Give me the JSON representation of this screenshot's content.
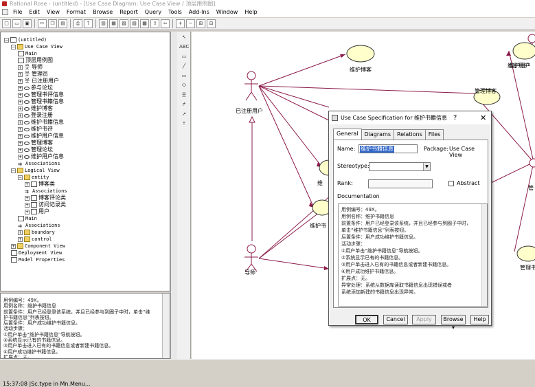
{
  "window": {
    "title": "Rational Rose - (untitled) - [Use Case Diagram: Use Case View / 顶层用例图]"
  },
  "menu": [
    "File",
    "Edit",
    "View",
    "Format",
    "Browse",
    "Report",
    "Query",
    "Tools",
    "Add-Ins",
    "Window",
    "Help"
  ],
  "browser": {
    "root": "(untitled)",
    "items": [
      {
        "label": "Use Case View",
        "icon": "folder",
        "level": 1,
        "mono": true
      },
      {
        "label": "Main",
        "icon": "diagram",
        "level": 2,
        "mono": true
      },
      {
        "label": "顶层用例图",
        "icon": "diagram",
        "level": 2
      },
      {
        "label": "导师",
        "icon": "actor",
        "level": 2
      },
      {
        "label": "管理员",
        "icon": "actor",
        "level": 2
      },
      {
        "label": "已注册用户",
        "icon": "actor",
        "level": 2
      },
      {
        "label": "参与论坛",
        "icon": "usecase",
        "level": 2
      },
      {
        "label": "管理书评信息",
        "icon": "usecase",
        "level": 2
      },
      {
        "label": "管理书籍信息",
        "icon": "usecase",
        "level": 2
      },
      {
        "label": "维护博客",
        "icon": "usecase",
        "level": 2
      },
      {
        "label": "登录注册",
        "icon": "usecase",
        "level": 2
      },
      {
        "label": "维护书籍信息",
        "icon": "usecase",
        "level": 2
      },
      {
        "label": "维护书评",
        "icon": "usecase",
        "level": 2
      },
      {
        "label": "维护用户信息",
        "icon": "usecase",
        "level": 2
      },
      {
        "label": "管理博客",
        "icon": "usecase",
        "level": 2
      },
      {
        "label": "管理论坛",
        "icon": "usecase",
        "level": 2
      },
      {
        "label": "维护用户信息",
        "icon": "usecase",
        "level": 2
      },
      {
        "label": "Associations",
        "icon": "assoc",
        "level": 2,
        "mono": true
      },
      {
        "label": "Logical View",
        "icon": "folder",
        "level": 1,
        "mono": true
      },
      {
        "label": "entity",
        "icon": "folder",
        "level": 2,
        "mono": true
      },
      {
        "label": "博客类",
        "icon": "class",
        "level": 3
      },
      {
        "label": "Associations",
        "icon": "assoc",
        "level": 3,
        "mono": true
      },
      {
        "label": "博客评论类",
        "icon": "class",
        "level": 3
      },
      {
        "label": "访问记录类",
        "icon": "class",
        "level": 3
      },
      {
        "label": "用户",
        "icon": "class",
        "level": 3
      },
      {
        "label": "Main",
        "icon": "diagram",
        "level": 2,
        "mono": true
      },
      {
        "label": "Associations",
        "icon": "assoc",
        "level": 2,
        "mono": true
      },
      {
        "label": "boundary",
        "icon": "folder",
        "level": 2,
        "mono": true
      },
      {
        "label": "control",
        "icon": "folder",
        "level": 2,
        "mono": true
      },
      {
        "label": "Component View",
        "icon": "folder",
        "level": 1,
        "mono": true
      },
      {
        "label": "Deployment View",
        "icon": "diagram",
        "level": 1,
        "mono": true
      },
      {
        "label": "Model Properties",
        "icon": "doc",
        "level": 1,
        "mono": true
      }
    ]
  },
  "docpane": {
    "lines": [
      "用例编号：49X。",
      "用例名称：维护书籍信息",
      "前置条件：用户已经登录该系统，并且已经参与到圈子中时，单击“维",
      "护书籍信息”列表按钮。",
      "后置条件：用户成功维护书籍信息。",
      "活动步骤：",
      "①用户单击“维护书籍信息”导航按钮。",
      "②系统显示已有的书籍信息。",
      "③用户单击进入已有的书籍信息或者新建书籍信息。",
      "④用户成功维护书籍信息。",
      "扩展点：无。",
      "异常处理：系统从数据库读取书籍信息出现错误或者",
      "系统添加新建的书籍信息出现异常。"
    ]
  },
  "diagram": {
    "actors": [
      {
        "label": "已注册用户"
      },
      {
        "label": "导师"
      },
      {
        "label": "维护用户"
      },
      {
        "label": "管"
      }
    ],
    "usecases": [
      {
        "label": "维护博客"
      },
      {
        "label": "管理博客"
      },
      {
        "label": "维护用户"
      },
      {
        "label": "维"
      },
      {
        "label": "维护书"
      },
      {
        "label": "管理书"
      }
    ]
  },
  "dialog": {
    "title": "Use Case Specification for 维护书籍信息",
    "help": "?",
    "close": "✕",
    "tabs": [
      "General",
      "Diagrams",
      "Relations",
      "Files"
    ],
    "name_label": "Name:",
    "name_value": "维护书籍信息",
    "package_label": "Package:",
    "package_value": "Use Case View",
    "stereotype_label": "Stereotype:",
    "rank_label": "Rank:",
    "abstract_label": "Abstract",
    "documentation_label": "Documentation",
    "doc_lines": [
      "用例编号：49X。",
      "用例名称：维护书籍信息",
      "前置条件：用户已经登录该系统，并且已经参与到圈子中时，",
      "单击“维护书籍信息”列表按钮。",
      "后置条件：用户成功维护书籍信息。",
      "活动步骤：",
      "①用户单击“维护书籍信息”导航按钮。",
      "②系统显示已有的书籍信息。",
      "③用户单击进入已有的书籍信息或者新建书籍信息。",
      "④用户成功维护书籍信息。",
      "扩展点：无。",
      "异常处理：系统从数据库读取书籍信息出现错误或者",
      "系统添加新建的书籍信息出现异常。"
    ],
    "buttons": {
      "ok": "OK",
      "cancel": "Cancel",
      "apply": "Apply",
      "browse": "Browse ▾",
      "help": "Help"
    }
  },
  "status": {
    "text": "15:37:08 |Sc.type in Mn.Menu..."
  },
  "colors": {
    "usecase_fill": "#ffffcc",
    "assoc_line": "#8b1a4a",
    "selection": "#3368c8"
  }
}
